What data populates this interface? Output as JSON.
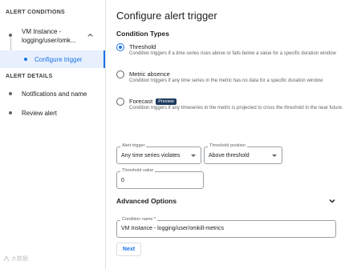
{
  "sidebar": {
    "alert_conditions_label": "ALERT CONDITIONS",
    "condition_item": {
      "label_line1": "VM Instance -",
      "label_line2": "logging/user/omk..."
    },
    "configure_trigger_label": "Configure trigger",
    "alert_details_label": "ALERT DETAILS",
    "notifications_label": "Notifications and name",
    "review_label": "Review alert"
  },
  "main": {
    "title": "Configure alert trigger",
    "condition_types_label": "Condition Types",
    "condition_types": [
      {
        "label": "Threshold",
        "description": "Condition triggers if a time series rises above or falls below a value for a specific duration window",
        "selected": true
      },
      {
        "label": "Metric absence",
        "description": "Condition triggers if any time series in the metric has no data for a specific duration window",
        "selected": false
      },
      {
        "label": "Forecast",
        "badge": "Preview",
        "description": "Condition triggers if any timeseries in the metric is projected to cross the threshold in the near future.",
        "selected": false
      }
    ],
    "alert_trigger": {
      "label": "Alert trigger",
      "value": "Any time series violates"
    },
    "threshold_position": {
      "label": "Threshold position",
      "value": "Above threshold"
    },
    "threshold_value": {
      "label": "Threshold value",
      "value": "0"
    },
    "advanced_options_label": "Advanced Options",
    "condition_name": {
      "label": "Condition name *",
      "value": "VM Instance - logging/user/omkill-metrics"
    },
    "next_label": "Next"
  },
  "watermark": {
    "text": "大数据"
  },
  "colors": {
    "accent": "#1a73e8",
    "active_bg": "#e8f0fe",
    "badge_bg": "#1e3a5f"
  }
}
